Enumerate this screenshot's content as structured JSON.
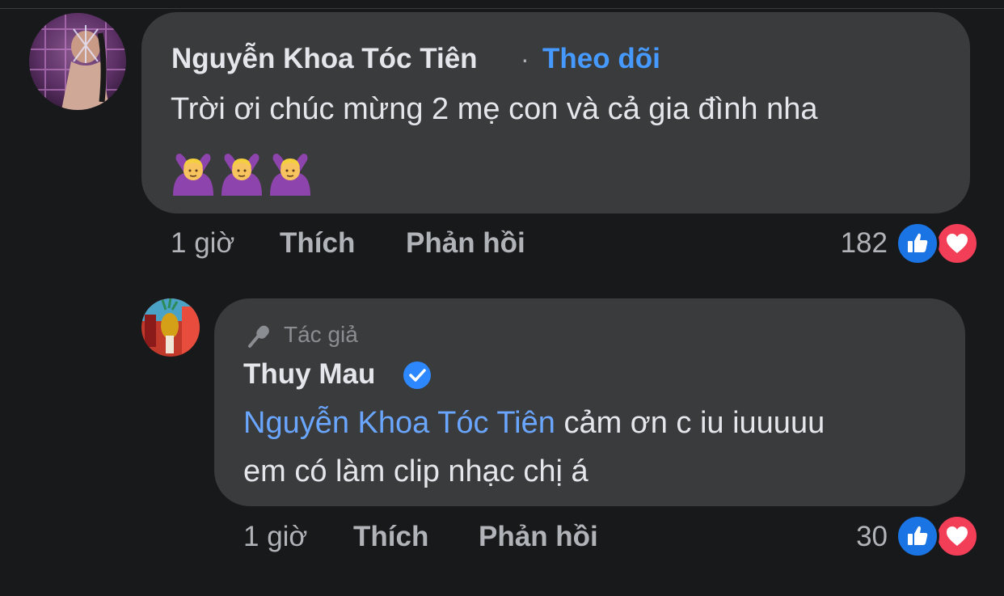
{
  "comment": {
    "author": "Nguyễn Khoa Tóc Tiên",
    "separator": "·",
    "follow_label": "Theo dõi",
    "text": "Trời ơi chúc mừng 2 mẹ con và cả gia đình nha",
    "emojis": [
      "🙆‍♀️",
      "🙆‍♀️",
      "🙆‍♀️"
    ],
    "time": "1 giờ",
    "like_label": "Thích",
    "reply_label": "Phản hồi",
    "reaction_count": "182",
    "reactions": [
      "like-icon",
      "love-icon"
    ]
  },
  "reply": {
    "badge_label": "Tác giả",
    "badge_icon": "microphone-icon",
    "author": "Thuy Mau",
    "verified": true,
    "mention": "Nguyễn Khoa Tóc Tiên",
    "text_line1": " cảm ơn c iu iuuuuu",
    "text_line2": "em có làm clip nhạc chị á",
    "time": "1 giờ",
    "like_label": "Thích",
    "reply_label": "Phản hồi",
    "reaction_count": "30",
    "reactions": [
      "like-icon",
      "love-icon"
    ]
  },
  "colors": {
    "background": "#18191a",
    "bubble": "#3a3b3c",
    "link": "#4599ff",
    "mention": "#6aa6ff",
    "like": "#1b74e4",
    "love": "#f33e58",
    "muted": "#b0b3b8"
  }
}
